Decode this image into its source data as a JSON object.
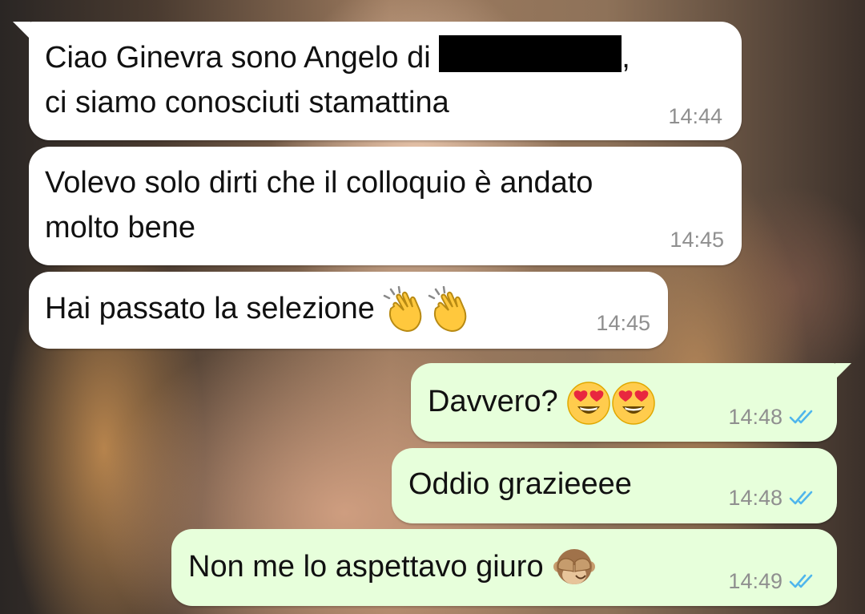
{
  "messages": [
    {
      "direction": "incoming",
      "line1": "Ciao Ginevra sono Angelo di",
      "line1_suffix": ",",
      "redacted": true,
      "line2": "ci siamo conosciuti stamattina",
      "time": "14:44"
    },
    {
      "direction": "incoming",
      "line1": "Volevo solo dirti che il colloquio è andato",
      "line2": "molto bene",
      "time": "14:45"
    },
    {
      "direction": "incoming",
      "text": "Hai passato la selezione",
      "emoji": [
        "clapping-hands-icon",
        "clapping-hands-icon"
      ],
      "time": "14:45"
    },
    {
      "direction": "outgoing",
      "text": "Davvero?",
      "emoji": [
        "heart-eyes-face-icon",
        "heart-eyes-face-icon"
      ],
      "time": "14:48",
      "status": "read"
    },
    {
      "direction": "outgoing",
      "text": "Oddio grazieeee",
      "time": "14:48",
      "status": "read"
    },
    {
      "direction": "outgoing",
      "text": "Non me lo aspettavo giuro",
      "emoji": [
        "see-no-evil-monkey-icon"
      ],
      "time": "14:49",
      "status": "read"
    }
  ],
  "colors": {
    "incoming_bubble": "#ffffff",
    "outgoing_bubble": "#e7ffdb",
    "timestamp": "#8f8f8f",
    "read_ticks": "#4fb6ec"
  }
}
